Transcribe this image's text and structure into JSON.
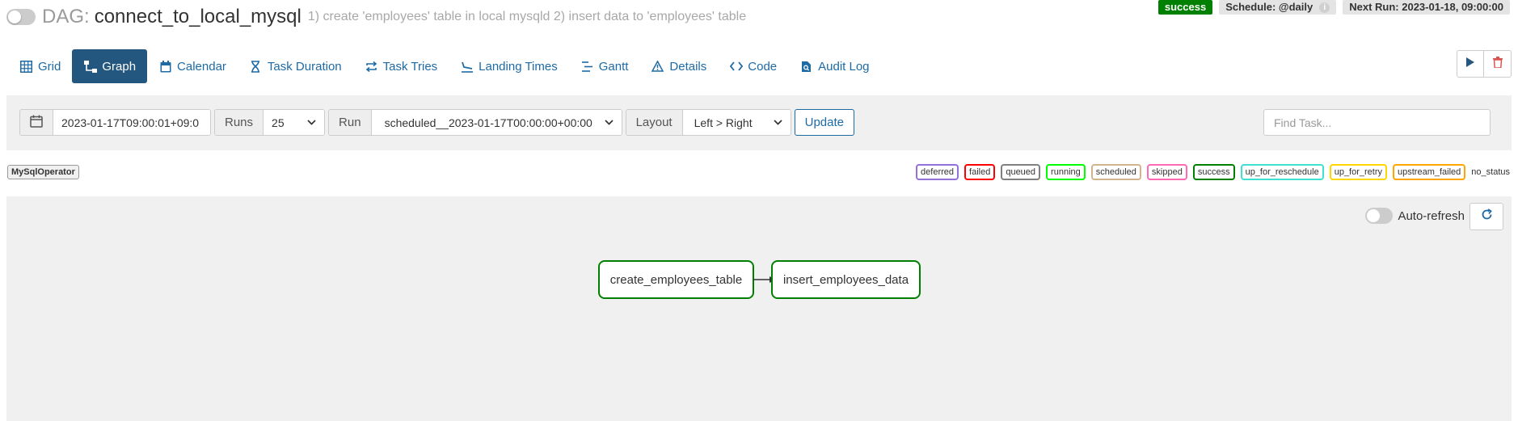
{
  "dag": {
    "prefix": "DAG:",
    "id": "connect_to_local_mysql",
    "description": "1) create 'employees' table in local mysqld 2) insert data to 'employees' table"
  },
  "header": {
    "status": "success",
    "schedule": "Schedule: @daily",
    "next_run": "Next Run: 2023-01-18, 09:00:00",
    "info_icon": "i"
  },
  "nav": {
    "tabs": [
      {
        "label": "Grid",
        "icon": "grid-icon"
      },
      {
        "label": "Graph",
        "icon": "graph-icon"
      },
      {
        "label": "Calendar",
        "icon": "calendar-icon"
      },
      {
        "label": "Task Duration",
        "icon": "hourglass-icon"
      },
      {
        "label": "Task Tries",
        "icon": "repeat-icon"
      },
      {
        "label": "Landing Times",
        "icon": "plane-landing-icon"
      },
      {
        "label": "Gantt",
        "icon": "gantt-icon"
      },
      {
        "label": "Details",
        "icon": "warning-icon"
      },
      {
        "label": "Code",
        "icon": "code-icon"
      },
      {
        "label": "Audit Log",
        "icon": "file-search-icon"
      }
    ],
    "active": "Graph"
  },
  "filters": {
    "base_date": "2023-01-17T09:00:01+09:0",
    "runs_label": "Runs",
    "runs_value": "25",
    "run_label": "Run",
    "run_value": "scheduled__2023-01-17T00:00:00+00:00",
    "layout_label": "Layout",
    "layout_value": "Left > Right",
    "update_label": "Update",
    "find_placeholder": "Find Task..."
  },
  "operator": "MySqlOperator",
  "legend": [
    {
      "label": "deferred",
      "color": "#9370db"
    },
    {
      "label": "failed",
      "color": "#ff0000"
    },
    {
      "label": "queued",
      "color": "#808080"
    },
    {
      "label": "running",
      "color": "#00ff00"
    },
    {
      "label": "scheduled",
      "color": "#d2b48c"
    },
    {
      "label": "skipped",
      "color": "#ff69b4"
    },
    {
      "label": "success",
      "color": "#008000"
    },
    {
      "label": "up_for_reschedule",
      "color": "#40e0d0"
    },
    {
      "label": "up_for_retry",
      "color": "#ffd700"
    },
    {
      "label": "upstream_failed",
      "color": "#ffa500"
    },
    {
      "label": "no_status",
      "color": ""
    }
  ],
  "graph": {
    "auto_refresh_label": "Auto-refresh",
    "nodes": [
      {
        "label": "create_employees_table",
        "state": "success"
      },
      {
        "label": "insert_employees_data",
        "state": "success"
      }
    ]
  },
  "colors": {
    "accent": "#1d6aa5",
    "active_tab": "#24577f",
    "success": "#008000"
  }
}
